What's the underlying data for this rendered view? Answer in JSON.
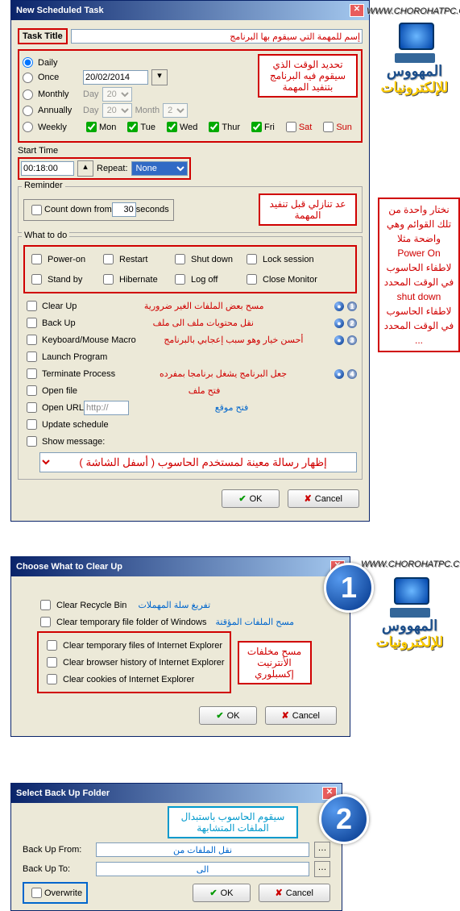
{
  "watermark_url": "WWW.CHOROHATPC.COM",
  "wordmark1": "المهووس",
  "wordmark2": "للإلكترونيات",
  "dlg1": {
    "title": "New Scheduled Task",
    "task_title_label": "Task Title",
    "task_title_hint": "إسم للمهمة التي سيقوم بها البرنامج",
    "schedule": {
      "daily": "Daily",
      "once": "Once",
      "once_date": "20/02/2014",
      "monthly": "Monthly",
      "annually": "Annually",
      "weekly": "Weekly",
      "day_lbl": "Day",
      "month_lbl": "Month",
      "day_val": "20",
      "month_val": "2",
      "days": {
        "mon": "Mon",
        "tue": "Tue",
        "wed": "Wed",
        "thur": "Thur",
        "fri": "Fri",
        "sat": "Sat",
        "sun": "Sun"
      }
    },
    "schedule_ann": "تحديد الوقت الذي سيقوم فيه البرنامج بتنفيد المهمة",
    "start_time_lbl": "Start Time",
    "start_time_val": "00:18:00",
    "repeat_lbl": "Repeat:",
    "repeat_val": "None",
    "reminder_lbl": "Reminder",
    "countdown_lbl": "Count down from",
    "countdown_val": "30",
    "seconds_lbl": "seconds",
    "reminder_ann": "عد تنازلي قبل تنفيد المهمة",
    "what_lbl": "What to do",
    "what_ann": "نختار واحدة من تلك القوائم وهي واضحة مثلا\nPower On\nلاطفاء الحاسوب في الوقت المحدد\nshut down\nلاطفاء الحاسوب في الوقت المحدد\n...",
    "opts": {
      "poweron": "Power-on",
      "restart": "Restart",
      "shutdown": "Shut down",
      "lock": "Lock session",
      "standby": "Stand by",
      "hibernate": "Hibernate",
      "logoff": "Log off",
      "closemon": "Close Monitor"
    },
    "actions": {
      "clearup": {
        "lbl": "Clear Up",
        "desc": "مسح بعض الملفات الغير ضرورية",
        "num": "1"
      },
      "backup": {
        "lbl": "Back Up",
        "desc": "نقل محتويات ملف الى ملف",
        "num": "2"
      },
      "kbm": {
        "lbl": "Keyboard/Mouse Macro",
        "desc": "أحسن خيار وهو سبب إعجابي بالبرنامج",
        "num": "3"
      },
      "launch": {
        "lbl": "Launch Program",
        "desc": ""
      },
      "term": {
        "lbl": "Terminate Process",
        "desc": "جعل البرنامج يشغل برنامجا بمفرده",
        "num": "4"
      },
      "openfile": {
        "lbl": "Open file",
        "desc": "فتح ملف"
      },
      "openurl": {
        "lbl": "Open URL",
        "urlprefix": "http://",
        "desc": "فتح موقع"
      },
      "update": {
        "lbl": "Update schedule"
      },
      "showmsg": {
        "lbl": "Show message:"
      }
    },
    "msg_placeholder": "إظهار رسالة معينة لمستخدم الحاسوب  ( أسفل الشاشة )",
    "ok": "OK",
    "cancel": "Cancel"
  },
  "dlg2": {
    "title": "Choose What to Clear Up",
    "items": {
      "recycle": {
        "lbl": "Clear Recycle Bin",
        "desc": "تفريغ سلة المهملات"
      },
      "tempwin": {
        "lbl": "Clear temporary file folder of Windows",
        "desc": "مسح الملفات المؤقتة"
      },
      "tempie": {
        "lbl": "Clear temporary files of Internet Explorer"
      },
      "histie": {
        "lbl": "Clear browser history of Internet Explorer"
      },
      "cookie": {
        "lbl": "Clear cookies of Internet Explorer"
      }
    },
    "ie_ann": "مسح مخلفات الأنترنيت إكسبلوري",
    "ok": "OK",
    "cancel": "Cancel"
  },
  "dlg3": {
    "title": "Select Back Up Folder",
    "ann": "سيقوم الحاسوب باستبدال الملفات المتشابهة",
    "from_lbl": "Back Up From:",
    "from_desc": "نقل الملفات من",
    "to_lbl": "Back Up To:",
    "to_desc": "الى",
    "overwrite": "Overwrite",
    "ok": "OK",
    "cancel": "Cancel"
  }
}
